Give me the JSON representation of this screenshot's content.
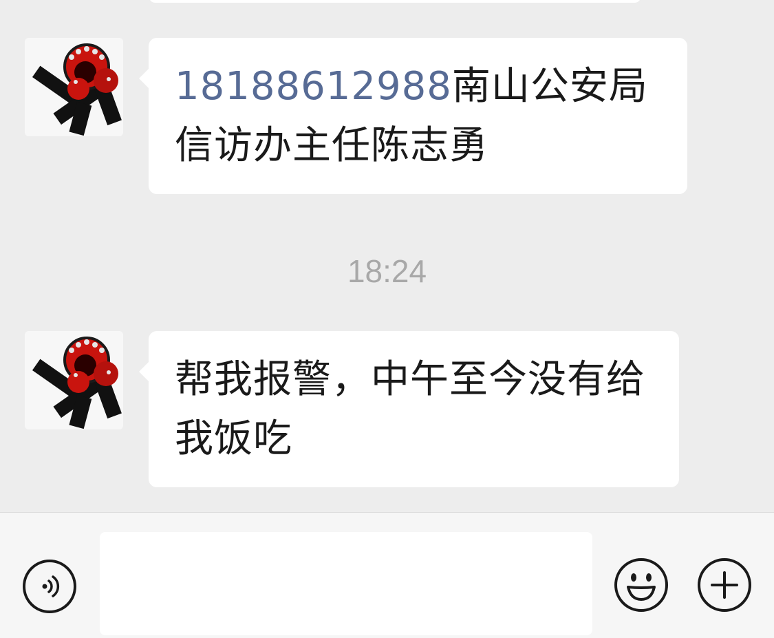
{
  "messages": [
    {
      "sender_avatar": "avatar-icon",
      "link_text": "18188612988",
      "text": "南山公安局信访办主任陈志勇"
    },
    {
      "sender_avatar": "avatar-icon",
      "text": "帮我报警，中午至今没有给我饭吃"
    }
  ],
  "timestamp": "18:24",
  "input_bar": {
    "voice_icon": "voice-icon",
    "emoji_icon": "emoji-icon",
    "plus_icon": "plus-icon",
    "input_value": ""
  },
  "colors": {
    "background": "#ededed",
    "bubble": "#ffffff",
    "link": "#576b95",
    "timestamp": "#a8a8a8"
  }
}
